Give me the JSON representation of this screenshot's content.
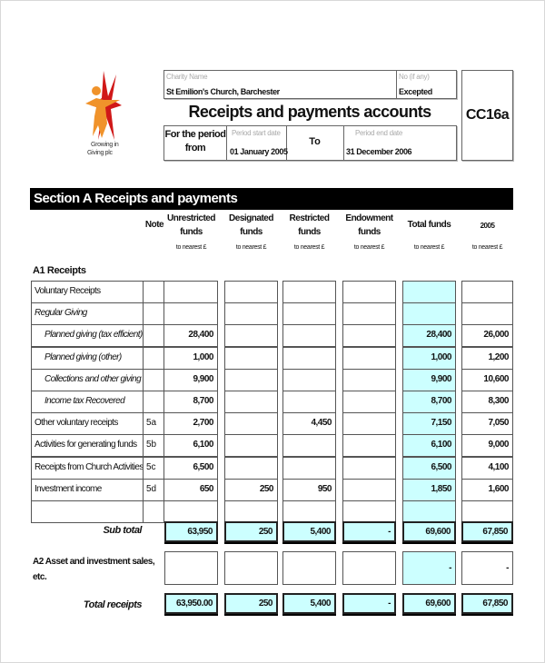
{
  "logo": {
    "caption_line1": "Growing in",
    "caption_line2": "Giving plc"
  },
  "header": {
    "charity_name_label": "Charity Name",
    "charity_name": "St Emilion's Church, Barchester",
    "number_label": "No (if any)",
    "number": "Excepted",
    "title": "Receipts and payments accounts",
    "form_code": "CC16a",
    "period_label_line1": "For the period",
    "period_label_line2": "from",
    "start_label": "Period start date",
    "start_date": "01 January 2005",
    "to_label": "To",
    "end_label": "Period end date",
    "end_date": "31 December 2006"
  },
  "section": {
    "title": "Section A Receipts and payments",
    "note_header": "Note",
    "columns": [
      {
        "line1": "Unrestricted",
        "line2": "funds",
        "sub": "to nearest £"
      },
      {
        "line1": "Designated",
        "line2": "funds",
        "sub": "to nearest £"
      },
      {
        "line1": "Restricted",
        "line2": "funds",
        "sub": "to nearest £"
      },
      {
        "line1": "Endowment",
        "line2": "funds",
        "sub": "to nearest £"
      },
      {
        "line1": "Total funds",
        "line2": "",
        "sub": "to nearest £"
      },
      {
        "line1": "2005",
        "line2": "",
        "sub": "to nearest £"
      }
    ],
    "a1_label": "A1 Receipts",
    "rows": [
      {
        "label": "Voluntary Receipts",
        "note": "",
        "values": [
          "",
          "",
          "",
          "",
          "",
          ""
        ]
      },
      {
        "label": "Regular Giving",
        "note": "",
        "values": [
          "",
          "",
          "",
          "",
          "",
          ""
        ]
      },
      {
        "label": "Planned giving (tax efficient)",
        "note": "",
        "values": [
          "28,400",
          "",
          "",
          "",
          "28,400",
          "26,000"
        ]
      },
      {
        "label": "Planned giving (other)",
        "note": "",
        "values": [
          "1,000",
          "",
          "",
          "",
          "1,000",
          "1,200"
        ]
      },
      {
        "label": "Collections and other giving",
        "note": "",
        "values": [
          "9,900",
          "",
          "",
          "",
          "9,900",
          "10,600"
        ]
      },
      {
        "label": "Income tax Recovered",
        "note": "",
        "values": [
          "8,700",
          "",
          "",
          "",
          "8,700",
          "8,300"
        ]
      },
      {
        "label": "Other voluntary receipts",
        "note": "5a",
        "values": [
          "2,700",
          "",
          "4,450",
          "",
          "7,150",
          "7,050"
        ]
      },
      {
        "label": "Activities for generating funds",
        "note": "5b",
        "values": [
          "6,100",
          "",
          "",
          "",
          "6,100",
          "9,000"
        ]
      },
      {
        "label": "Receipts from Church Activities",
        "note": "5c",
        "values": [
          "6,500",
          "",
          "",
          "",
          "6,500",
          "4,100"
        ]
      },
      {
        "label": "Investment income",
        "note": "5d",
        "values": [
          "650",
          "250",
          "950",
          "",
          "1,850",
          "1,600"
        ]
      },
      {
        "label": "",
        "note": "",
        "values": [
          "",
          "",
          "",
          "",
          "",
          ""
        ]
      }
    ],
    "subtotal": {
      "label": "Sub total",
      "values": [
        "63,950",
        "250",
        "5,400",
        "-",
        "69,600",
        "67,850"
      ]
    },
    "a2": {
      "label_line1": "A2 Asset and investment sales,",
      "label_line2": "etc.",
      "values": [
        "",
        "",
        "",
        "",
        "-",
        "-"
      ]
    },
    "total": {
      "label": "Total receipts",
      "values": [
        "63,950.00",
        "250",
        "5,400",
        "-",
        "69,600",
        "67,850"
      ]
    }
  }
}
